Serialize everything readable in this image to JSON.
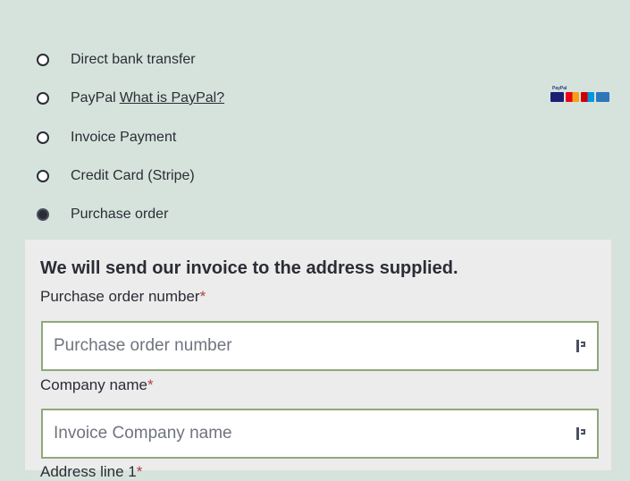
{
  "payment_methods": [
    {
      "label": "Direct bank transfer",
      "selected": false
    },
    {
      "label": "PayPal",
      "link": "What is PayPal?",
      "selected": false
    },
    {
      "label": "Invoice Payment",
      "selected": false
    },
    {
      "label": "Credit Card (Stripe)",
      "selected": false
    },
    {
      "label": "Purchase order",
      "selected": true
    }
  ],
  "paypal_cards": {
    "mark": "PayPal",
    "icons": [
      "visa-card-icon",
      "mastercard-icon",
      "maestro-card-icon",
      "amex-card-icon"
    ]
  },
  "purchase_order": {
    "heading": "We will send our invoice to the address supplied.",
    "required_marker": "*",
    "po_number": {
      "label": "Purchase order number",
      "placeholder": "Purchase order number",
      "value": ""
    },
    "company_name": {
      "label": "Company name",
      "placeholder": "Invoice Company name",
      "value": ""
    },
    "address_line_1": {
      "label": "Address line 1"
    }
  },
  "colors": {
    "background": "#d6e3dc",
    "panel": "#ececec",
    "input_border": "#8fa97a",
    "required": "#b0413e",
    "text": "#2b2d35"
  }
}
